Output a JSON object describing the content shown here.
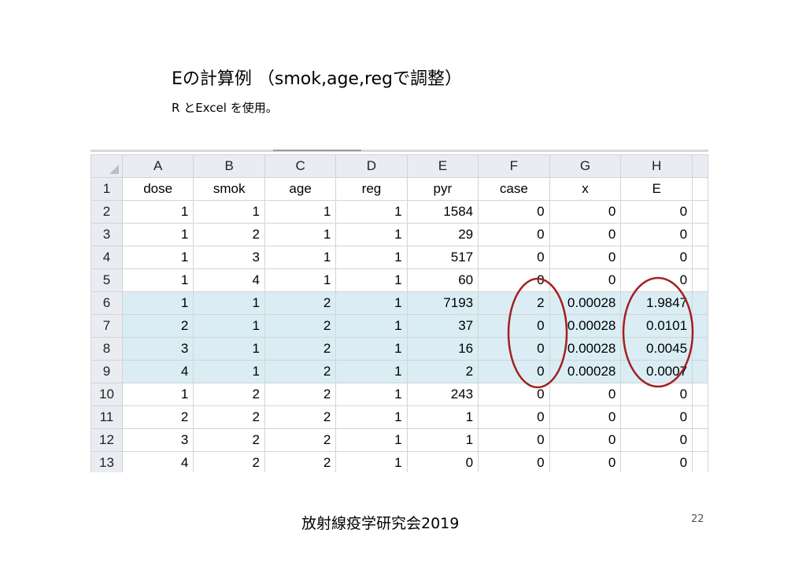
{
  "slide": {
    "title": "Eの計算例 （smok,age,regで調整）",
    "subtitle": "R とExcel を使用。",
    "footer": "放射線疫学研究会2019",
    "page_number": "22"
  },
  "sheet": {
    "column_letters": [
      "A",
      "B",
      "C",
      "D",
      "E",
      "F",
      "G",
      "H"
    ],
    "header_row": {
      "row_number": "1",
      "cells": [
        "dose",
        "smok",
        "age",
        "reg",
        "pyr",
        "case",
        "x",
        "E"
      ]
    },
    "rows": [
      {
        "row_number": "2",
        "cells": [
          "1",
          "1",
          "1",
          "1",
          "1584",
          "0",
          "0",
          "0"
        ]
      },
      {
        "row_number": "3",
        "cells": [
          "1",
          "2",
          "1",
          "1",
          "29",
          "0",
          "0",
          "0"
        ]
      },
      {
        "row_number": "4",
        "cells": [
          "1",
          "3",
          "1",
          "1",
          "517",
          "0",
          "0",
          "0"
        ]
      },
      {
        "row_number": "5",
        "cells": [
          "1",
          "4",
          "1",
          "1",
          "60",
          "0",
          "0",
          "0"
        ]
      },
      {
        "row_number": "6",
        "cells": [
          "1",
          "1",
          "2",
          "1",
          "7193",
          "2",
          "0.00028",
          "1.9847"
        ]
      },
      {
        "row_number": "7",
        "cells": [
          "2",
          "1",
          "2",
          "1",
          "37",
          "0",
          "0.00028",
          "0.0101"
        ]
      },
      {
        "row_number": "8",
        "cells": [
          "3",
          "1",
          "2",
          "1",
          "16",
          "0",
          "0.00028",
          "0.0045"
        ]
      },
      {
        "row_number": "9",
        "cells": [
          "4",
          "1",
          "2",
          "1",
          "2",
          "0",
          "0.00028",
          "0.0007"
        ]
      },
      {
        "row_number": "10",
        "cells": [
          "1",
          "2",
          "2",
          "1",
          "243",
          "0",
          "0",
          "0"
        ]
      },
      {
        "row_number": "11",
        "cells": [
          "2",
          "2",
          "2",
          "1",
          "1",
          "0",
          "0",
          "0"
        ]
      },
      {
        "row_number": "12",
        "cells": [
          "3",
          "2",
          "2",
          "1",
          "1",
          "0",
          "0",
          "0"
        ]
      },
      {
        "row_number": "13",
        "cells": [
          "4",
          "2",
          "2",
          "1",
          "0",
          "0",
          "0",
          "0"
        ]
      }
    ],
    "highlight_color": "#daedf4",
    "oval_color": "#a31f1f"
  }
}
